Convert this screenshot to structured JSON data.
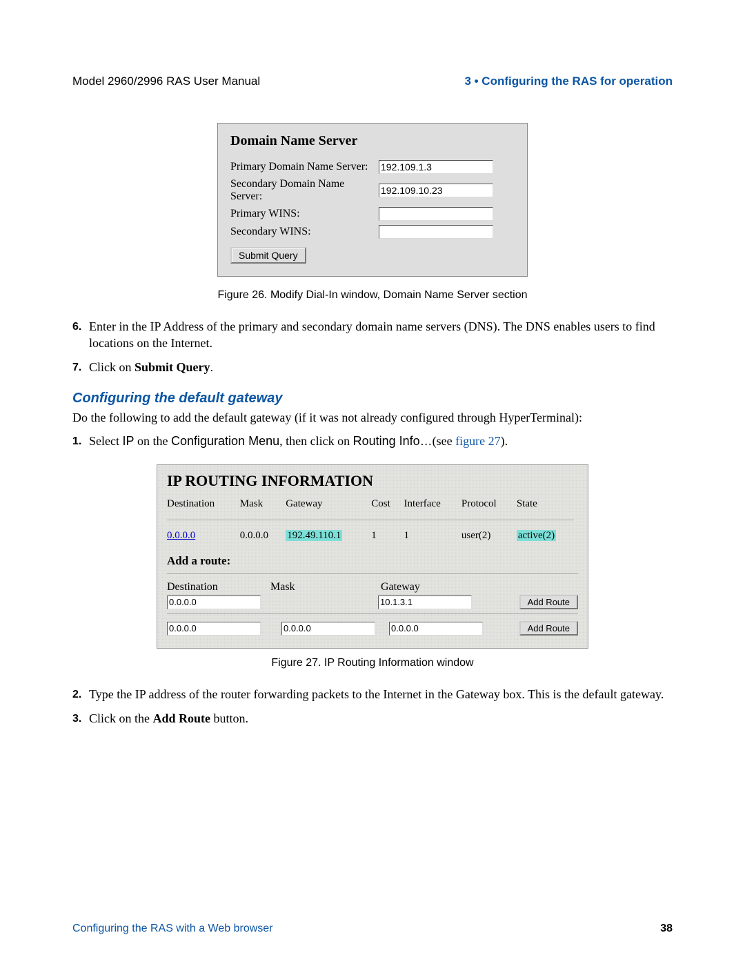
{
  "header": {
    "left": "Model 2960/2996 RAS User Manual",
    "right": "3 • Configuring the RAS for operation"
  },
  "fig26": {
    "title": "Domain Name Server",
    "rows": {
      "primary_dns_label": "Primary Domain Name Server:",
      "primary_dns_value": "192.109.1.3",
      "secondary_dns_label": "Secondary Domain Name Server:",
      "secondary_dns_value": "192.109.10.23",
      "primary_wins_label": "Primary WINS:",
      "primary_wins_value": "",
      "secondary_wins_label": "Secondary WINS:",
      "secondary_wins_value": ""
    },
    "submit": "Submit Query",
    "caption": "Figure 26. Modify Dial-In window, Domain Name Server section"
  },
  "list1": {
    "item6_num": "6.",
    "item6_text": "Enter in the IP Address of the primary and secondary domain name servers (DNS). The DNS enables users to find locations on the Internet.",
    "item7_num": "7.",
    "item7_prefix": "Click on ",
    "item7_bold": "Submit Query",
    "item7_suffix": "."
  },
  "section2": {
    "heading": "Configuring the default gateway",
    "intro": "Do the following to add the default gateway (if it was not already configured through HyperTerminal):"
  },
  "list2": {
    "item1_num": "1.",
    "item1_prefix": "Select ",
    "item1_ip": "IP",
    "item1_mid1": " on the ",
    "item1_cfg": "Configuration Menu",
    "item1_mid2": ", then click on ",
    "item1_route": "Routing Info…",
    "item1_suffix1": "(see ",
    "item1_link": "figure 27",
    "item1_suffix2": ")."
  },
  "fig27": {
    "title": "IP ROUTING INFORMATION",
    "headers": {
      "dest": "Destination",
      "mask": "Mask",
      "gateway": "Gateway",
      "cost": "Cost",
      "iface": "Interface",
      "proto": "Protocol",
      "state": "State"
    },
    "row": {
      "dest": "0.0.0.0",
      "mask": "0.0.0.0",
      "gateway": "192.49.110.1",
      "cost": "1",
      "iface": "1",
      "proto": "user(2)",
      "state": "active(2)"
    },
    "add_title": "Add a route:",
    "form_labels": {
      "dest": "Destination",
      "mask": "Mask",
      "gateway": "Gateway"
    },
    "form1": {
      "dest": "0.0.0.0",
      "mask": "",
      "gateway": "10.1.3.1"
    },
    "form2": {
      "dest": "0.0.0.0",
      "mask": "0.0.0.0",
      "gateway": "0.0.0.0"
    },
    "add_button": "Add Route",
    "caption": "Figure 27. IP Routing Information window"
  },
  "list3": {
    "item2_num": "2.",
    "item2_text": "Type the IP address of the router forwarding packets to the Internet in the Gateway box. This is the default gateway.",
    "item3_num": "3.",
    "item3_prefix": "Click on the ",
    "item3_bold": "Add Route",
    "item3_suffix": " button."
  },
  "footer": {
    "left": "Configuring the RAS with a Web browser",
    "right": "38"
  }
}
